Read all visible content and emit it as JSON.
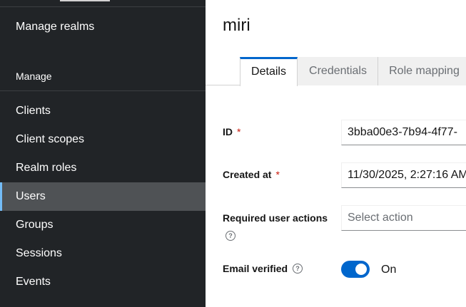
{
  "sidebar": {
    "manage_realms": "Manage realms",
    "section_label": "Manage",
    "items": [
      {
        "label": "Clients"
      },
      {
        "label": "Client scopes"
      },
      {
        "label": "Realm roles"
      },
      {
        "label": "Users"
      },
      {
        "label": "Groups"
      },
      {
        "label": "Sessions"
      },
      {
        "label": "Events"
      }
    ],
    "active_item": "Users"
  },
  "main": {
    "title": "miri",
    "tabs": [
      {
        "label": "Details"
      },
      {
        "label": "Credentials"
      },
      {
        "label": "Role mapping"
      }
    ],
    "active_tab": "Details",
    "form": {
      "id_label": "ID",
      "id_value": "3bba00e3-7b94-4f77-",
      "created_label": "Created at",
      "created_value": "11/30/2025, 2:27:16 AM",
      "required_actions_label": "Required user actions",
      "required_actions_placeholder": "Select action",
      "email_verified_label": "Email verified",
      "email_verified_state": "On",
      "required_marker": "*"
    }
  },
  "colors": {
    "sidebar_bg": "#212427",
    "active_item_bg": "#4f5255",
    "active_indicator": "#73bcf7",
    "accent": "#0066cc",
    "required": "#c9190b"
  }
}
